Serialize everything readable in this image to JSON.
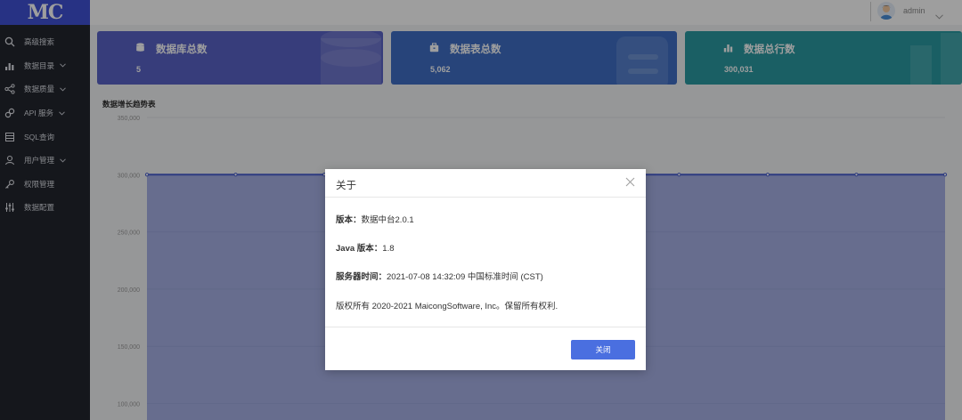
{
  "sidebar": {
    "logo": "MC",
    "items": [
      {
        "label": "高级搜索",
        "icon": "search-icon",
        "chevron": false
      },
      {
        "label": "数据目录",
        "icon": "bar-chart-icon",
        "chevron": true
      },
      {
        "label": "数据质量",
        "icon": "share-icon",
        "chevron": true
      },
      {
        "label": "API 服务",
        "icon": "link-icon",
        "chevron": true
      },
      {
        "label": "SQL查询",
        "icon": "table-icon",
        "chevron": false
      },
      {
        "label": "用户管理",
        "icon": "user-icon",
        "chevron": true
      },
      {
        "label": "权限管理",
        "icon": "key-icon",
        "chevron": false
      },
      {
        "label": "数据配置",
        "icon": "sliders-icon",
        "chevron": false
      }
    ]
  },
  "header": {
    "username": "admin"
  },
  "cards": [
    {
      "title": "数据库总数",
      "value": "5",
      "icon": "database-icon",
      "color": "#5a63c7"
    },
    {
      "title": "数据表总数",
      "value": "5,062",
      "icon": "briefcase-icon",
      "color": "#3f6fc6"
    },
    {
      "title": "数据总行数",
      "value": "300,031",
      "icon": "bar-chart-icon",
      "color": "#2a9aa2"
    }
  ],
  "chart_title": "数据增长趋势表",
  "chart_data": {
    "type": "area",
    "title": "数据增长趋势表",
    "y_ticks": [
      "350,000",
      "300,000",
      "250,000",
      "200,000",
      "150,000",
      "100,000"
    ],
    "ylim": [
      100000,
      350000
    ],
    "series": [
      {
        "values": [
          300031,
          300031,
          300031,
          300031,
          300031,
          300031,
          300031,
          300031,
          300031,
          300031
        ]
      }
    ],
    "color": "#4a5fd0",
    "grid": true
  },
  "modal": {
    "title": "关于",
    "version_label": "版本：",
    "version_value": "数据中台2.0.1",
    "java_label": "Java 版本：",
    "java_value": "1.8",
    "server_time_label": "服务器时间：",
    "server_time_value": "2021-07-08 14:32:09 中国标准时间 (CST)",
    "copyright": "版权所有 2020-2021 MaicongSoftware, Inc。保留所有权利.",
    "close_button": "关闭"
  }
}
